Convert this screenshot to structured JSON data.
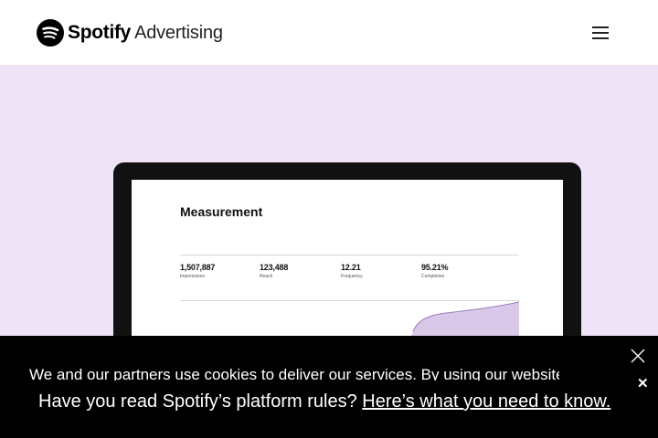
{
  "header": {
    "brand": "Spotify",
    "brand_suffix": "Advertising",
    "menu_icon": "hamburger-menu-icon"
  },
  "hero": {
    "laptop_screen": {
      "title": "Measurement",
      "metrics": [
        {
          "value": "1,507,887",
          "label": "Impressions"
        },
        {
          "value": "123,488",
          "label": "Reach"
        },
        {
          "value": "12.21",
          "label": "Frequency"
        },
        {
          "value": "95.21%",
          "label": "Completion"
        }
      ],
      "chart_color": "#c9b3dd"
    },
    "background_color": "#efe3f7"
  },
  "notice": {
    "behind_text": "We and our partners use cookies to deliver our services. By using our website",
    "message": "Have you read Spotify’s platform rules?",
    "link_text": "Here’s what you need to know.",
    "close_icon": "close-icon",
    "dismiss_icon": "dismiss-x-icon"
  }
}
